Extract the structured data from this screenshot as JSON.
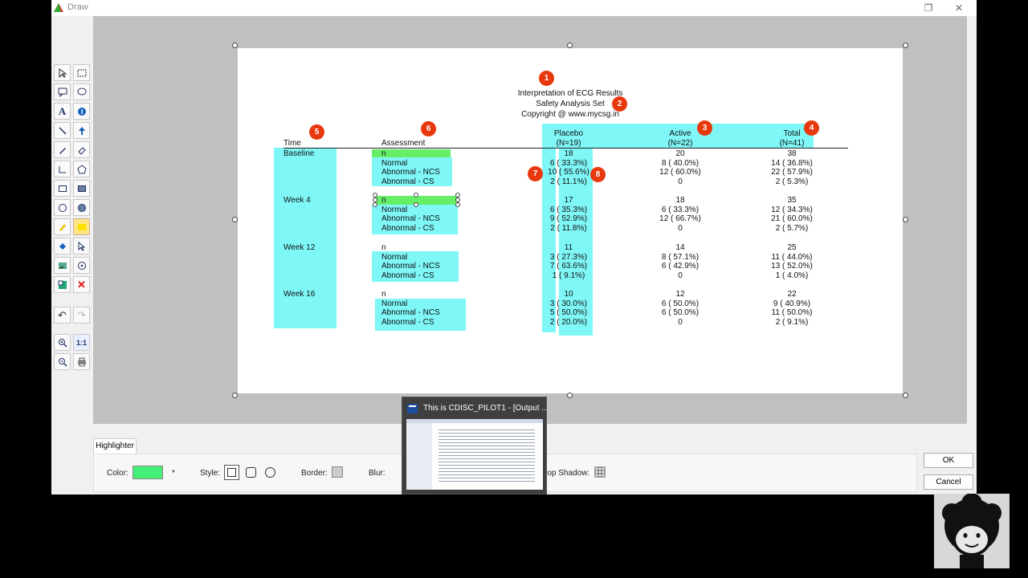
{
  "window": {
    "title": "Draw"
  },
  "toolbox": {
    "undo_glyph": "↶",
    "redo_glyph": "↷",
    "zoom_actual_label": "1:1"
  },
  "report": {
    "title": "Interpretation of ECG Results",
    "subtitle": "Safety Analysis Set",
    "copyright": "Copyright @ www.mycsg.in",
    "headers": {
      "time": "Time",
      "assessment": "Assessment",
      "placebo": "Placebo",
      "placebo_n": "(N=19)",
      "active": "Active",
      "active_n": "(N=22)",
      "total": "Total",
      "total_n": "(N=41)"
    },
    "groups": [
      {
        "time": "Baseline",
        "rows": [
          {
            "assessment": "n",
            "placebo": "18",
            "active": "20",
            "total": "38"
          },
          {
            "assessment": "Normal",
            "placebo": "6 ( 33.3%)",
            "active": "8 ( 40.0%)",
            "total": "14 ( 36.8%)"
          },
          {
            "assessment": "Abnormal - NCS",
            "placebo": "10 ( 55.6%)",
            "active": "12 ( 60.0%)",
            "total": "22 ( 57.9%)"
          },
          {
            "assessment": "Abnormal - CS",
            "placebo": "2 ( 11.1%)",
            "active": "0",
            "total": "2 ( 5.3%)"
          }
        ]
      },
      {
        "time": "Week 4",
        "rows": [
          {
            "assessment": "n",
            "placebo": "17",
            "active": "18",
            "total": "35"
          },
          {
            "assessment": "Normal",
            "placebo": "6 ( 35.3%)",
            "active": "6 ( 33.3%)",
            "total": "12 ( 34.3%)"
          },
          {
            "assessment": "Abnormal - NCS",
            "placebo": "9 ( 52.9%)",
            "active": "12 ( 66.7%)",
            "total": "21 ( 60.0%)"
          },
          {
            "assessment": "Abnormal - CS",
            "placebo": "2 ( 11.8%)",
            "active": "0",
            "total": "2 ( 5.7%)"
          }
        ]
      },
      {
        "time": "Week 12",
        "rows": [
          {
            "assessment": "n",
            "placebo": "11",
            "active": "14",
            "total": "25"
          },
          {
            "assessment": "Normal",
            "placebo": "3 ( 27.3%)",
            "active": "8 ( 57.1%)",
            "total": "11 ( 44.0%)"
          },
          {
            "assessment": "Abnormal - NCS",
            "placebo": "7 ( 63.6%)",
            "active": "6 ( 42.9%)",
            "total": "13 ( 52.0%)"
          },
          {
            "assessment": "Abnormal - CS",
            "placebo": "1 ( 9.1%)",
            "active": "0",
            "total": "1 ( 4.0%)"
          }
        ]
      },
      {
        "time": "Week 16",
        "rows": [
          {
            "assessment": "n",
            "placebo": "10",
            "active": "12",
            "total": "22"
          },
          {
            "assessment": "Normal",
            "placebo": "3 ( 30.0%)",
            "active": "6 ( 50.0%)",
            "total": "9 ( 40.9%)"
          },
          {
            "assessment": "Abnormal - NCS",
            "placebo": "5 ( 50.0%)",
            "active": "6 ( 50.0%)",
            "total": "11 ( 50.0%)"
          },
          {
            "assessment": "Abnormal - CS",
            "placebo": "2 ( 20.0%)",
            "active": "0",
            "total": "2 ( 9.1%)"
          }
        ]
      }
    ],
    "badges": [
      "1",
      "2",
      "3",
      "4",
      "5",
      "6",
      "7",
      "8"
    ]
  },
  "properties": {
    "tab_label": "Highlighter",
    "color_label": "Color:",
    "color_value": "#44ee77",
    "color_asterisk": "*",
    "style_label": "Style:",
    "border_label": "Border:",
    "blur_label": "Blur:",
    "shadow_label": "rop Shadow:"
  },
  "buttons": {
    "ok": "OK",
    "cancel": "Cancel"
  },
  "taskbar_thumbnail": {
    "title": "This is CDISC_PILOT1 - [Output ..."
  },
  "colors": {
    "highlight_cyan": "#7ff7f7",
    "highlight_green": "#66ee66",
    "badge": "#e8380d"
  }
}
